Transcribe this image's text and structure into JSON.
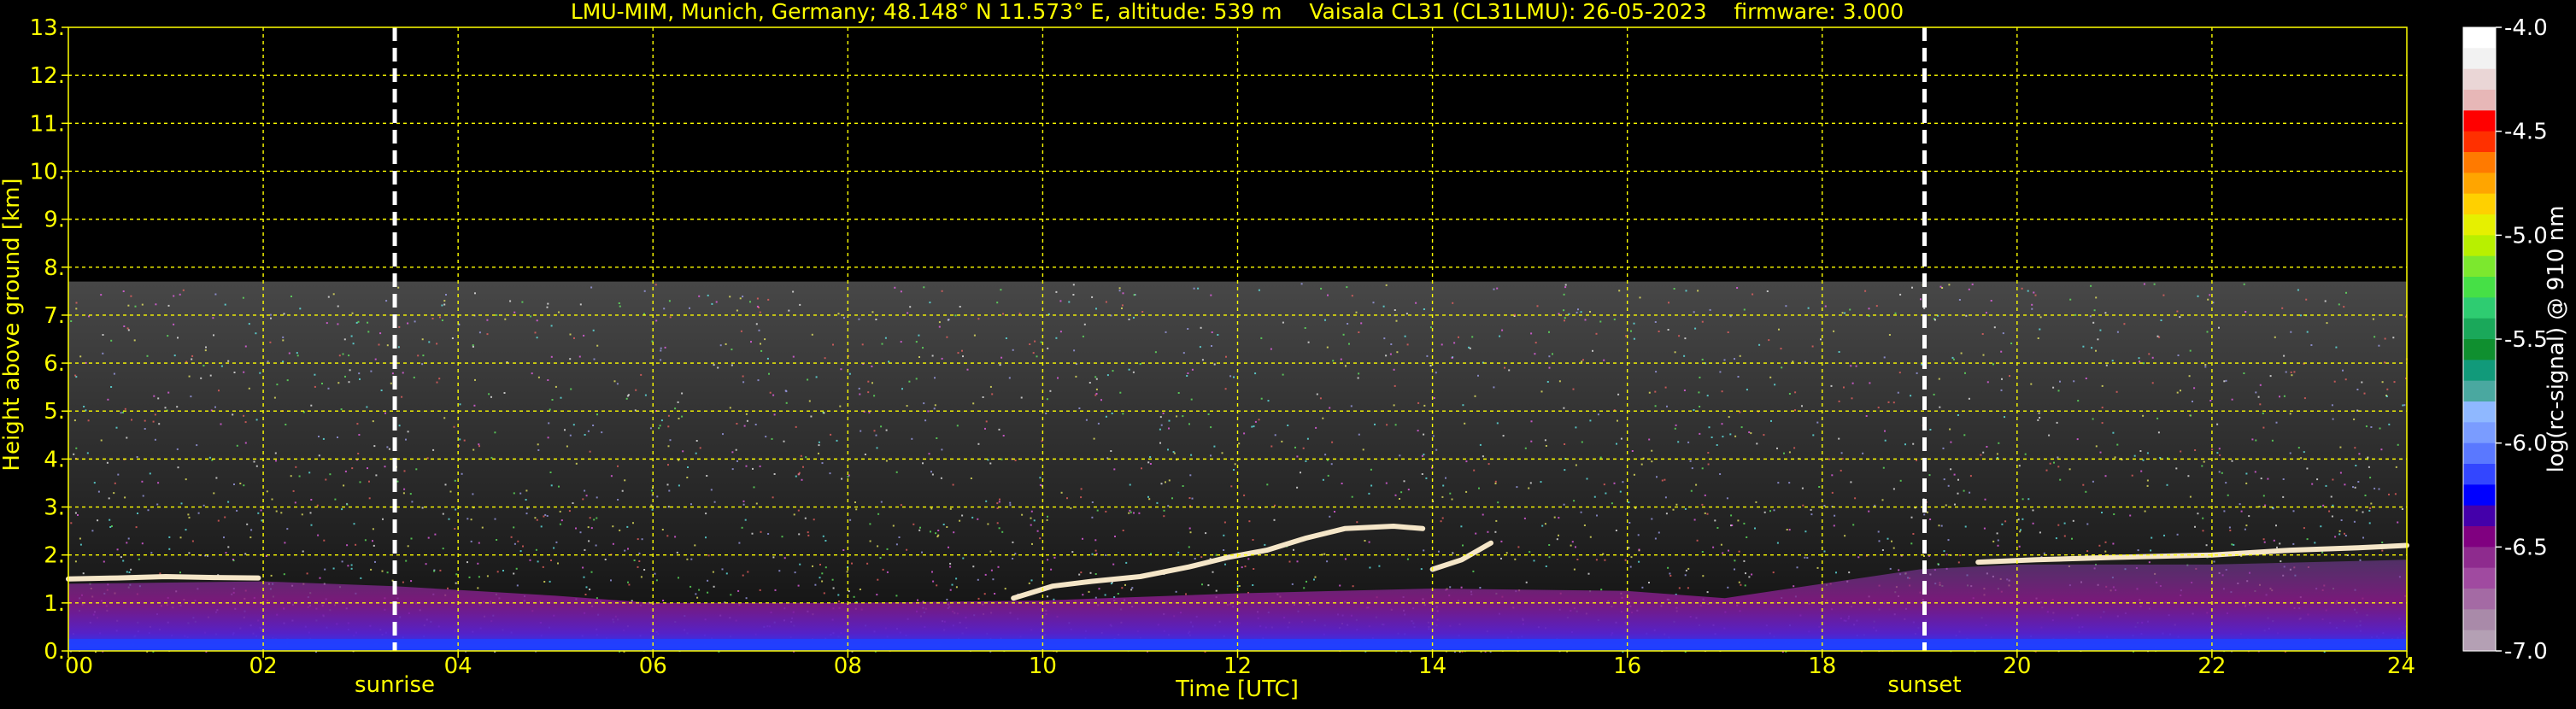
{
  "colors": {
    "background": "#000000",
    "text": "#ffff00",
    "grid": "#ffff00",
    "colorbar_text": "#ffffff",
    "event_lines": "#ffffff"
  },
  "chart_data": {
    "type": "heatmap",
    "title": "LMU-MIM, Munich, Germany; 48.148° N 11.573° E, altitude: 539 m    Vaisala CL31 (CL31LMU): 26-05-2023    firmware: 3.000",
    "xlabel": "Time [UTC]",
    "ylabel": "Height above ground [km]",
    "xlim": [
      0,
      24
    ],
    "ylim": [
      0,
      13
    ],
    "x_ticks": [
      0,
      2,
      4,
      6,
      8,
      10,
      12,
      14,
      16,
      18,
      20,
      22,
      24
    ],
    "x_tick_labels": [
      "00",
      "02",
      "04",
      "06",
      "08",
      "10",
      "12",
      "14",
      "16",
      "18",
      "20",
      "22",
      "24"
    ],
    "y_ticks": [
      0,
      1,
      2,
      3,
      4,
      5,
      6,
      7,
      8,
      9,
      10,
      11,
      12,
      13
    ],
    "y_tick_labels": [
      "0.",
      "1.",
      "2.",
      "3.",
      "4.",
      "5.",
      "6.",
      "7.",
      "8.",
      "9.",
      "10.",
      "11.",
      "12.",
      "13."
    ],
    "grid": true,
    "signal_top_km": 7.7,
    "events": [
      {
        "label": "sunrise",
        "x": 3.35
      },
      {
        "label": "sunset",
        "x": 19.05
      }
    ],
    "boundary_layer_top_km": [
      {
        "x": 0,
        "y": 1.4
      },
      {
        "x": 2,
        "y": 1.45
      },
      {
        "x": 3.35,
        "y": 1.35
      },
      {
        "x": 5,
        "y": 1.15
      },
      {
        "x": 6,
        "y": 1.0
      },
      {
        "x": 8,
        "y": 1.0
      },
      {
        "x": 10,
        "y": 1.05
      },
      {
        "x": 12,
        "y": 1.2
      },
      {
        "x": 14,
        "y": 1.3
      },
      {
        "x": 16,
        "y": 1.25
      },
      {
        "x": 17,
        "y": 1.1
      },
      {
        "x": 19,
        "y": 1.7
      },
      {
        "x": 20,
        "y": 1.8
      },
      {
        "x": 22,
        "y": 1.8
      },
      {
        "x": 24,
        "y": 1.9
      }
    ],
    "cloud_layers_km": [
      [
        {
          "x": 0,
          "y": 1.5
        },
        {
          "x": 0.5,
          "y": 1.52
        },
        {
          "x": 1,
          "y": 1.55
        },
        {
          "x": 1.5,
          "y": 1.53
        },
        {
          "x": 1.95,
          "y": 1.52
        }
      ],
      [
        {
          "x": 9.7,
          "y": 1.1
        },
        {
          "x": 10.1,
          "y": 1.35
        },
        {
          "x": 10.5,
          "y": 1.45
        },
        {
          "x": 11.0,
          "y": 1.55
        },
        {
          "x": 11.5,
          "y": 1.75
        },
        {
          "x": 11.9,
          "y": 1.95
        },
        {
          "x": 12.3,
          "y": 2.1
        },
        {
          "x": 12.7,
          "y": 2.35
        },
        {
          "x": 13.1,
          "y": 2.55
        },
        {
          "x": 13.6,
          "y": 2.6
        },
        {
          "x": 13.9,
          "y": 2.55
        }
      ],
      [
        {
          "x": 14.0,
          "y": 1.7
        },
        {
          "x": 14.3,
          "y": 1.9
        },
        {
          "x": 14.6,
          "y": 2.25
        }
      ],
      [
        {
          "x": 19.6,
          "y": 1.85
        },
        {
          "x": 20.2,
          "y": 1.9
        },
        {
          "x": 21.0,
          "y": 1.95
        },
        {
          "x": 22.0,
          "y": 2.0
        },
        {
          "x": 22.8,
          "y": 2.1
        },
        {
          "x": 23.5,
          "y": 2.15
        },
        {
          "x": 24.0,
          "y": 2.2
        }
      ]
    ],
    "colorbar": {
      "label": "log(rc-signal) @ 910 nm",
      "range": [
        -7.0,
        -4.0
      ],
      "ticks": [
        -4.0,
        -4.5,
        -5.0,
        -5.5,
        -6.0,
        -6.5,
        -7.0
      ],
      "tick_labels": [
        "-4.0",
        "-4.5",
        "-5.0",
        "-5.5",
        "-6.0",
        "-6.5",
        "-7.0"
      ],
      "colors_top_to_bottom": [
        "#ffffff",
        "#f2f2f2",
        "#ead6d6",
        "#e7b7b7",
        "#ff0000",
        "#ff3000",
        "#ff7a00",
        "#ffa500",
        "#ffd000",
        "#e6f000",
        "#b8f000",
        "#7ce82e",
        "#46e046",
        "#2ecc71",
        "#1aa85a",
        "#0f8f2f",
        "#119a7a",
        "#4aa8a0",
        "#8fb8ff",
        "#7a9cff",
        "#5a78ff",
        "#3346ff",
        "#0000ff",
        "#4400aa",
        "#800080",
        "#8e2b8e",
        "#a04aa0",
        "#a46aa4",
        "#a98aa9",
        "#b4a0b4"
      ]
    }
  }
}
